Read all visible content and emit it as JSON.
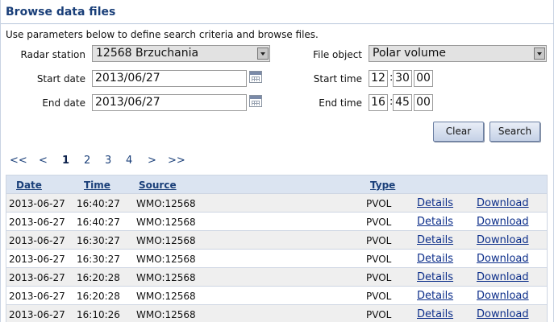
{
  "panel": {
    "title": "Browse data files",
    "description": "Use parameters below to define search criteria and browse files."
  },
  "form": {
    "radar_station_label": "Radar station",
    "radar_station_value": "12568 Brzuchania",
    "file_object_label": "File object",
    "file_object_value": "Polar volume",
    "start_date_label": "Start date",
    "start_date_value": "2013/06/27",
    "end_date_label": "End date",
    "end_date_value": "2013/06/27",
    "start_time_label": "Start time",
    "start_time": {
      "h": "12",
      "m": "30",
      "s": "00"
    },
    "end_time_label": "End time",
    "end_time": {
      "h": "16",
      "m": "45",
      "s": "00"
    },
    "clear_label": "Clear",
    "search_label": "Search",
    "time_separator": ":"
  },
  "pager": {
    "first": "<<",
    "prev": "<",
    "pages": [
      "1",
      "2",
      "3",
      "4"
    ],
    "current": "1",
    "next": ">",
    "last": ">>"
  },
  "table": {
    "headers": {
      "date": "Date",
      "time": "Time",
      "source": "Source",
      "type": "Type"
    },
    "rows": [
      {
        "date": "2013-06-27",
        "time": "16:40:27",
        "source": "WMO:12568",
        "type": "PVOL",
        "details": "Details",
        "download": "Download"
      },
      {
        "date": "2013-06-27",
        "time": "16:40:27",
        "source": "WMO:12568",
        "type": "PVOL",
        "details": "Details",
        "download": "Download"
      },
      {
        "date": "2013-06-27",
        "time": "16:30:27",
        "source": "WMO:12568",
        "type": "PVOL",
        "details": "Details",
        "download": "Download"
      },
      {
        "date": "2013-06-27",
        "time": "16:30:27",
        "source": "WMO:12568",
        "type": "PVOL",
        "details": "Details",
        "download": "Download"
      },
      {
        "date": "2013-06-27",
        "time": "16:20:28",
        "source": "WMO:12568",
        "type": "PVOL",
        "details": "Details",
        "download": "Download"
      },
      {
        "date": "2013-06-27",
        "time": "16:20:28",
        "source": "WMO:12568",
        "type": "PVOL",
        "details": "Details",
        "download": "Download"
      },
      {
        "date": "2013-06-27",
        "time": "16:10:26",
        "source": "WMO:12568",
        "type": "PVOL",
        "details": "Details",
        "download": "Download"
      }
    ]
  }
}
